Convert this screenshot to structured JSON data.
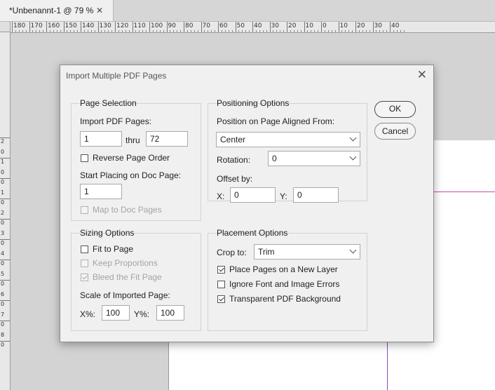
{
  "document_tab": {
    "title": "*Unbenannt-1 @ 79 %",
    "close_glyph": "✕"
  },
  "ruler_top": [
    "180",
    "170",
    "160",
    "150",
    "140",
    "130",
    "120",
    "110",
    "100",
    "90",
    "80",
    "70",
    "60",
    "50",
    "40",
    "30",
    "20",
    "10",
    "0",
    "10",
    "20",
    "30",
    "40"
  ],
  "ruler_left": [
    "2",
    "0",
    "1",
    "0",
    "0",
    "1",
    "0",
    "2",
    "0",
    "3",
    "0",
    "4",
    "0",
    "5",
    "0",
    "6",
    "0",
    "7",
    "0",
    "8",
    "0"
  ],
  "dialog": {
    "title": "Import Multiple PDF Pages",
    "close_glyph": "✕",
    "ok_label": "OK",
    "cancel_label": "Cancel",
    "page_selection": {
      "title": "Page Selection",
      "import_label": "Import PDF Pages:",
      "from_value": "1",
      "thru_label": "thru",
      "to_value": "72",
      "reverse_label": "Reverse Page Order",
      "reverse_checked": false,
      "start_label": "Start Placing on Doc Page:",
      "start_value": "1",
      "map_label": "Map to Doc Pages",
      "map_checked": false,
      "map_enabled": false
    },
    "positioning": {
      "title": "Positioning Options",
      "aligned_label": "Position on Page Aligned From:",
      "aligned_value": "Center",
      "rotation_label": "Rotation:",
      "rotation_value": "0",
      "offset_label": "Offset by:",
      "x_label": "X:",
      "x_value": "0",
      "y_label": "Y:",
      "y_value": "0"
    },
    "sizing": {
      "title": "Sizing Options",
      "fit_label": "Fit to Page",
      "fit_checked": false,
      "keep_label": "Keep Proportions",
      "keep_checked": false,
      "keep_enabled": false,
      "bleed_label": "Bleed the Fit Page",
      "bleed_checked": true,
      "bleed_enabled": false,
      "scale_label": "Scale of Imported Page:",
      "xpct_label": "X%:",
      "xpct_value": "100",
      "ypct_label": "Y%:",
      "ypct_value": "100"
    },
    "placement": {
      "title": "Placement Options",
      "crop_label": "Crop to:",
      "crop_value": "Trim",
      "new_layer_label": "Place Pages on a New Layer",
      "new_layer_checked": true,
      "ignore_label": "Ignore Font and Image Errors",
      "ignore_checked": false,
      "transparent_label": "Transparent PDF Background",
      "transparent_checked": true
    }
  },
  "colors": {
    "margin_guide": "#c04fa6",
    "column_guide": "#8a49c0"
  }
}
